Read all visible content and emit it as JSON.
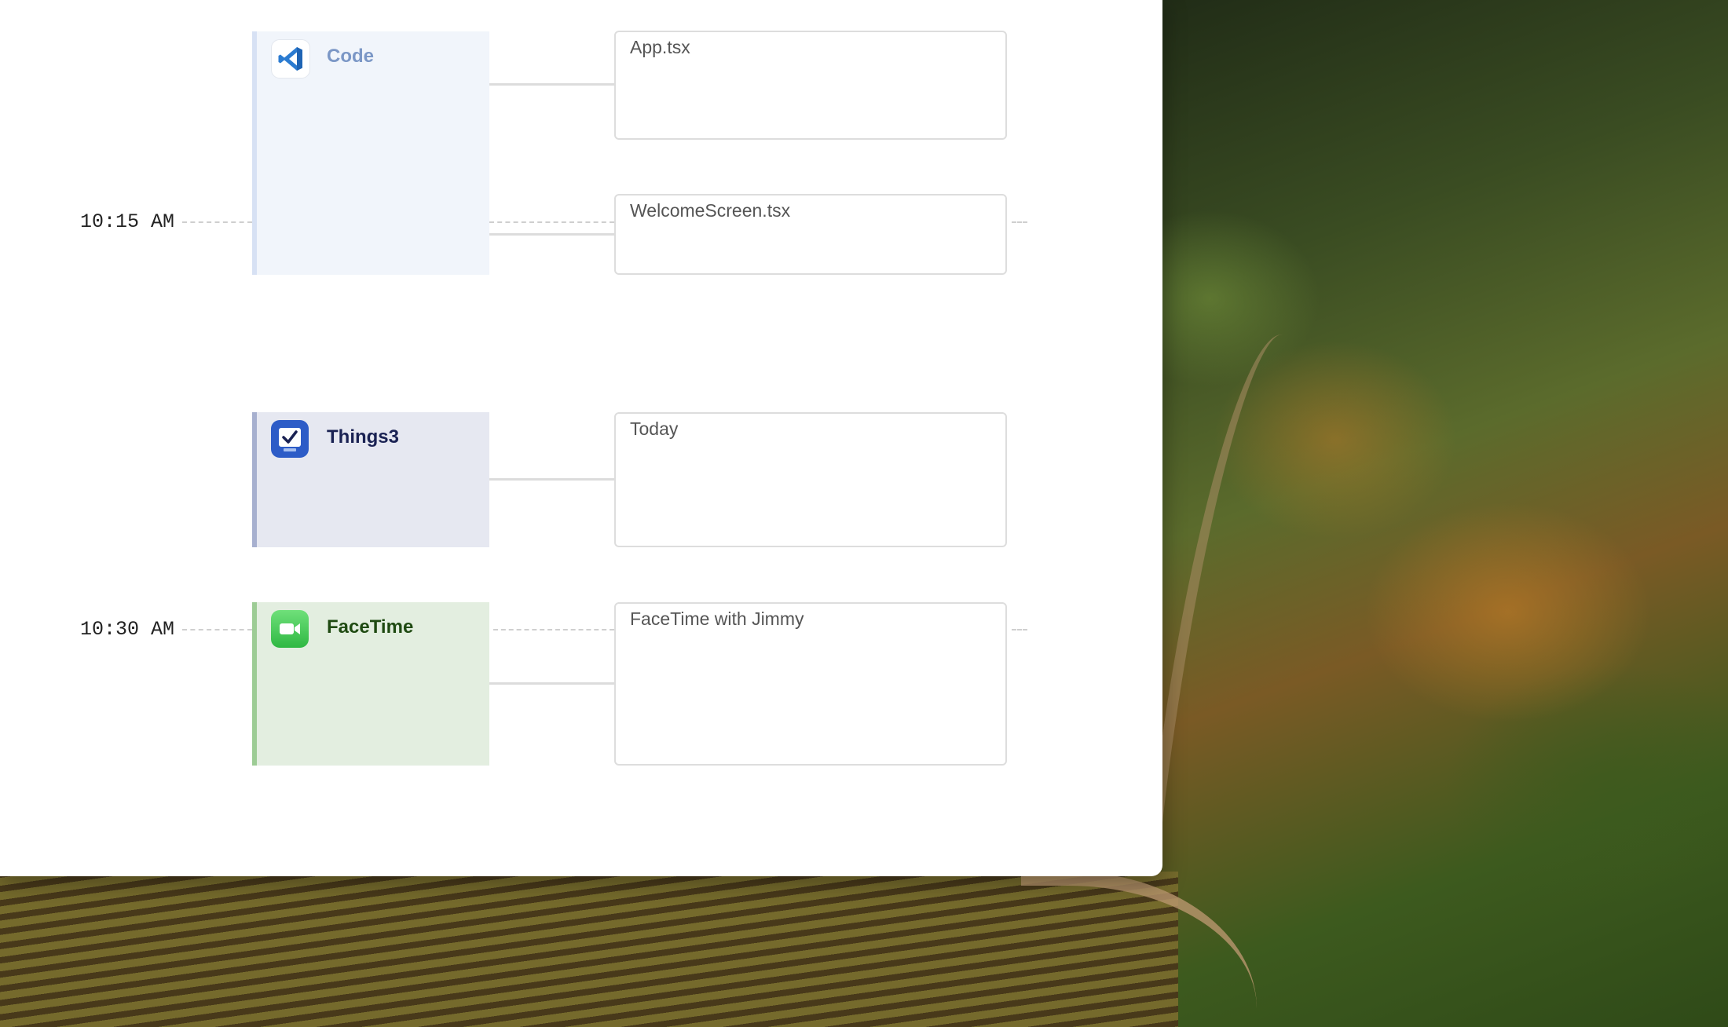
{
  "timeline": {
    "markers": [
      {
        "label": "10:15 AM"
      },
      {
        "label": "10:30 AM"
      }
    ],
    "apps": [
      {
        "name": "Code",
        "icon": "vscode-icon",
        "accent": "#d7e1f4",
        "bg": "#f1f5fb",
        "text_color": "#7b97c6"
      },
      {
        "name": "Things3",
        "icon": "things-checkbox-icon",
        "accent": "#a7b0cf",
        "bg": "#e6e8f1",
        "text_color": "#1a2253"
      },
      {
        "name": "FaceTime",
        "icon": "facetime-camera-icon",
        "accent": "#9dcc95",
        "bg": "#e3eee0",
        "text_color": "#1f4a12"
      }
    ],
    "documents": [
      {
        "title": "App.tsx"
      },
      {
        "title": "WelcomeScreen.tsx"
      },
      {
        "title": "Today"
      },
      {
        "title": "FaceTime with Jimmy"
      }
    ]
  }
}
